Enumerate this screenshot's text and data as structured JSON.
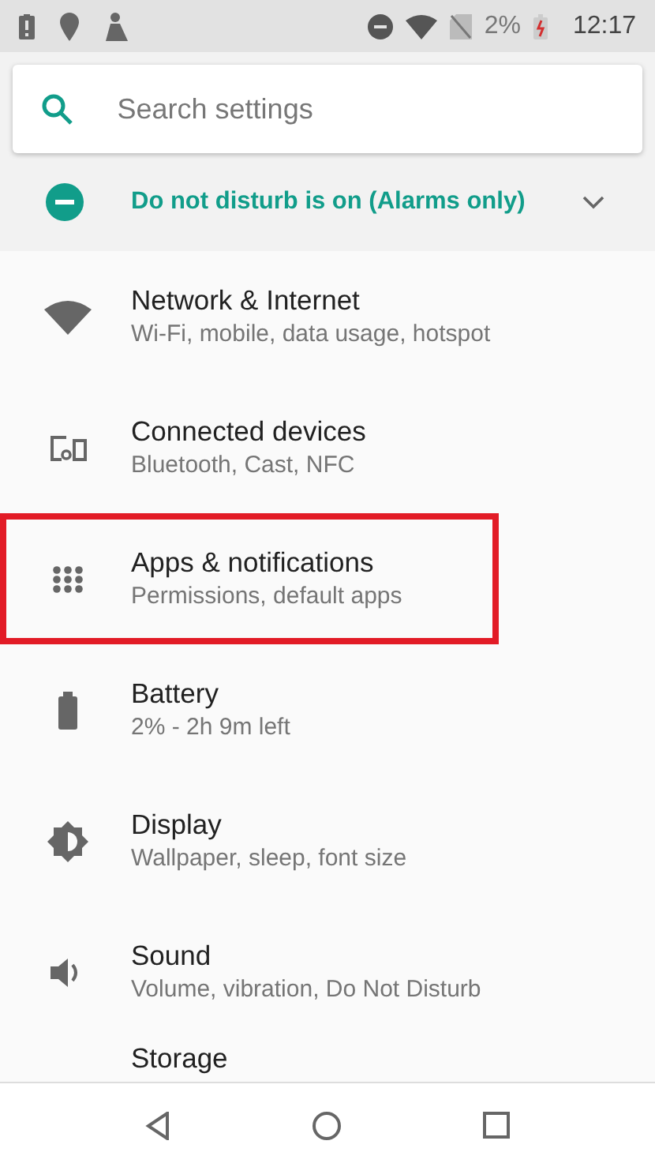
{
  "status_bar": {
    "battery_percent": "2%",
    "time": "12:17"
  },
  "search": {
    "placeholder": "Search settings"
  },
  "dnd_banner": {
    "text": "Do not disturb is on (Alarms only)",
    "expanded": false
  },
  "settings": [
    {
      "kind": "wifi",
      "title": "Network & Internet",
      "subtitle": "Wi-Fi, mobile, data usage, hotspot",
      "highlighted": false
    },
    {
      "kind": "devices",
      "title": "Connected devices",
      "subtitle": "Bluetooth, Cast, NFC",
      "highlighted": false
    },
    {
      "kind": "apps",
      "title": "Apps & notifications",
      "subtitle": "Permissions, default apps",
      "highlighted": true
    },
    {
      "kind": "battery",
      "title": "Battery",
      "subtitle": "2% - 2h 9m left",
      "highlighted": false
    },
    {
      "kind": "display",
      "title": "Display",
      "subtitle": "Wallpaper, sleep, font size",
      "highlighted": false
    },
    {
      "kind": "sound",
      "title": "Sound",
      "subtitle": "Volume, vibration, Do Not Disturb",
      "highlighted": false
    },
    {
      "kind": "storage",
      "title": "Storage",
      "highlighted": false
    }
  ]
}
